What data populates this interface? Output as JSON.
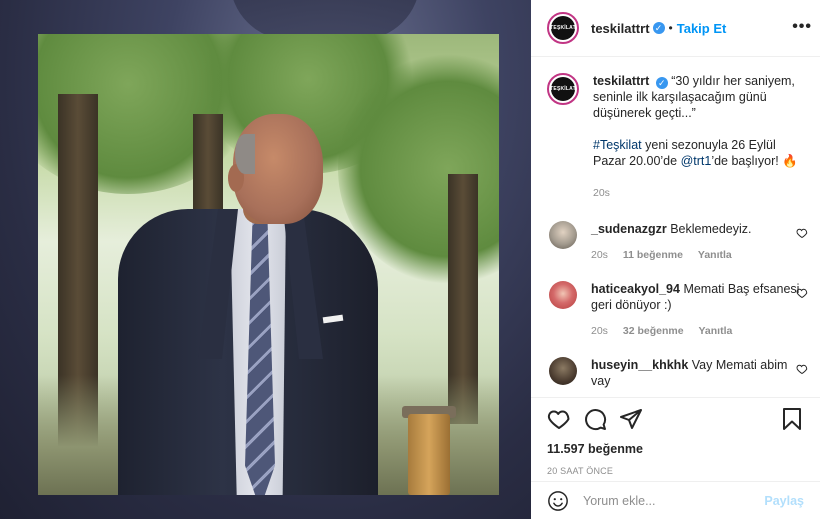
{
  "post": {
    "username": "teskilattrt",
    "avatar_text": "TEŞKİLAT",
    "follow_label": "Takip Et",
    "dot": "•",
    "more_label": "•••"
  },
  "caption": {
    "username": "teskilattrt",
    "quote": "“30 yıldır her saniyem, seninle ilk karşılaşacağım günü düşünerek geçti...”",
    "hashtag": "#Teşkilat",
    "text_mid": " yeni sezonuyla 26 Eylül Pazar 20.00’de ",
    "mention": "@trt1",
    "text_end": "’de başlıyor! 🔥",
    "time": "20s"
  },
  "comments": [
    {
      "username": "_sudenazgzr",
      "text": "Beklemedeyiz.",
      "time": "20s",
      "likes": "11 beğenme",
      "reply": "Yanıtla",
      "avatar_color": "#a29a8e"
    },
    {
      "username": "haticeakyol_94",
      "text": "Memati Baş efsanesi geri dönüyor :)",
      "time": "20s",
      "likes": "32 beğenme",
      "reply": "Yanıtla",
      "avatar_color": "#c75a5a"
    },
    {
      "username": "huseyin__khkhk",
      "text": "Vay Memati abim vay",
      "time": "",
      "likes": "",
      "reply": "",
      "avatar_color": "#4a3b2f"
    }
  ],
  "actions": {
    "like_count": "11.597 beğenme",
    "post_time": "20 SAAT ÖNCE"
  },
  "add_comment": {
    "placeholder": "Yorum ekle...",
    "post_label": "Paylaş"
  },
  "colors": {
    "link_blue": "#0095f6",
    "verified_blue": "#3897f0",
    "muted_text": "#8e8e8e",
    "story_ring": "#c13584"
  }
}
